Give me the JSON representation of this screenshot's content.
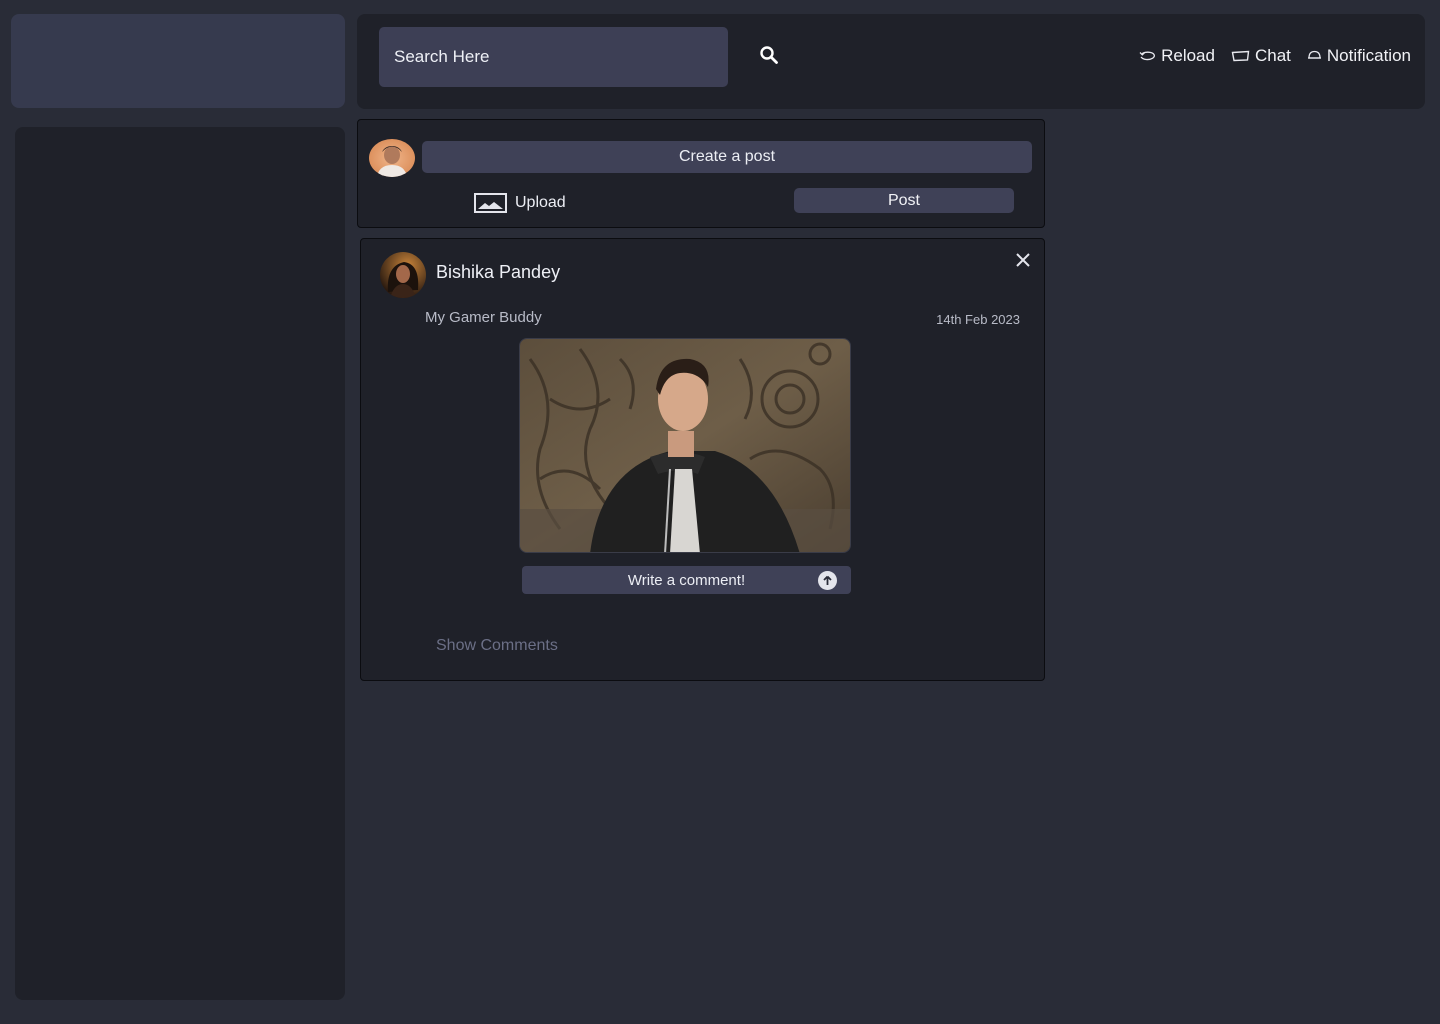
{
  "topbar": {
    "search_placeholder": "Search Here",
    "actions": [
      {
        "label": "Reload",
        "icon": "reload-icon"
      },
      {
        "label": "Chat",
        "icon": "chat-icon"
      },
      {
        "label": "Notification",
        "icon": "bell-icon"
      }
    ]
  },
  "composer": {
    "placeholder": "Create a post",
    "upload_label": "Upload",
    "post_label": "Post"
  },
  "post": {
    "author": "Bishika Pandey",
    "caption": "My Gamer Buddy",
    "date": "14th Feb 2023",
    "comment_placeholder": "Write  a comment!",
    "show_comments": "Show  Comments"
  },
  "colors": {
    "page_bg": "#292c37",
    "panel_bg": "#1f2129",
    "input_bg": "#3f4157",
    "muted_link": "#6b6f86"
  }
}
